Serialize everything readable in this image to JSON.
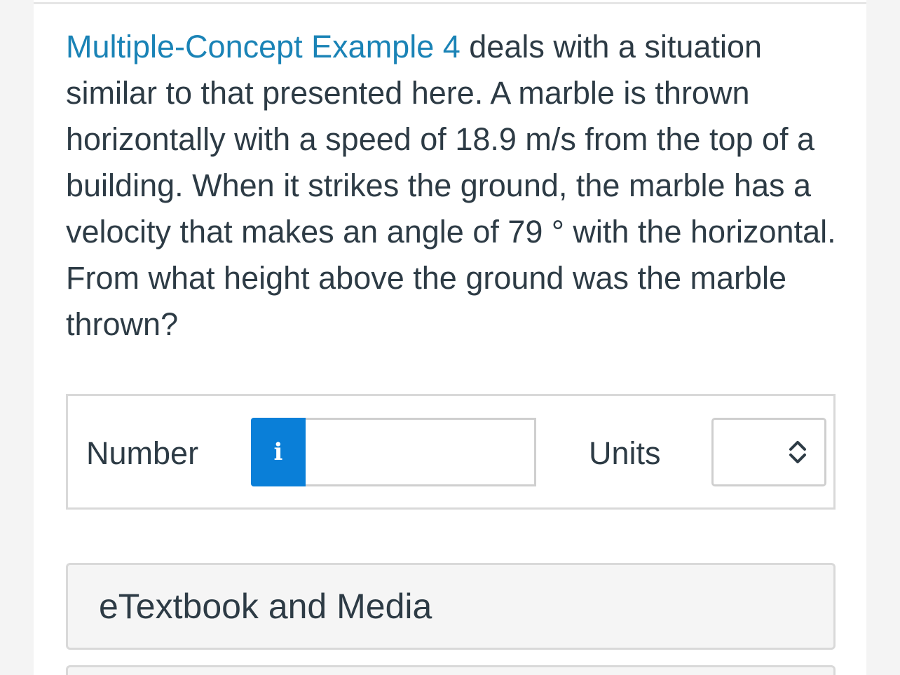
{
  "question": {
    "link_text": "Multiple-Concept Example 4",
    "body_text": " deals with a situation similar to that presented here. A marble is thrown horizontally with a speed of 18.9 m/s from the top of a building. When it strikes the ground, the marble has a velocity that makes an angle of 79 ° with the horizontal. From what height above the ground was the marble thrown?"
  },
  "answer": {
    "number_label": "Number",
    "info_icon": "info-icon",
    "info_glyph": "i",
    "number_value": "",
    "units_label": "Units",
    "units_selected": "",
    "units_icon": "chevron-up-down-icon"
  },
  "resources": {
    "etextbook_label": "eTextbook and Media"
  },
  "colors": {
    "link": "#1a83b6",
    "text": "#2d3b45",
    "info_button": "#0a7fd8"
  }
}
